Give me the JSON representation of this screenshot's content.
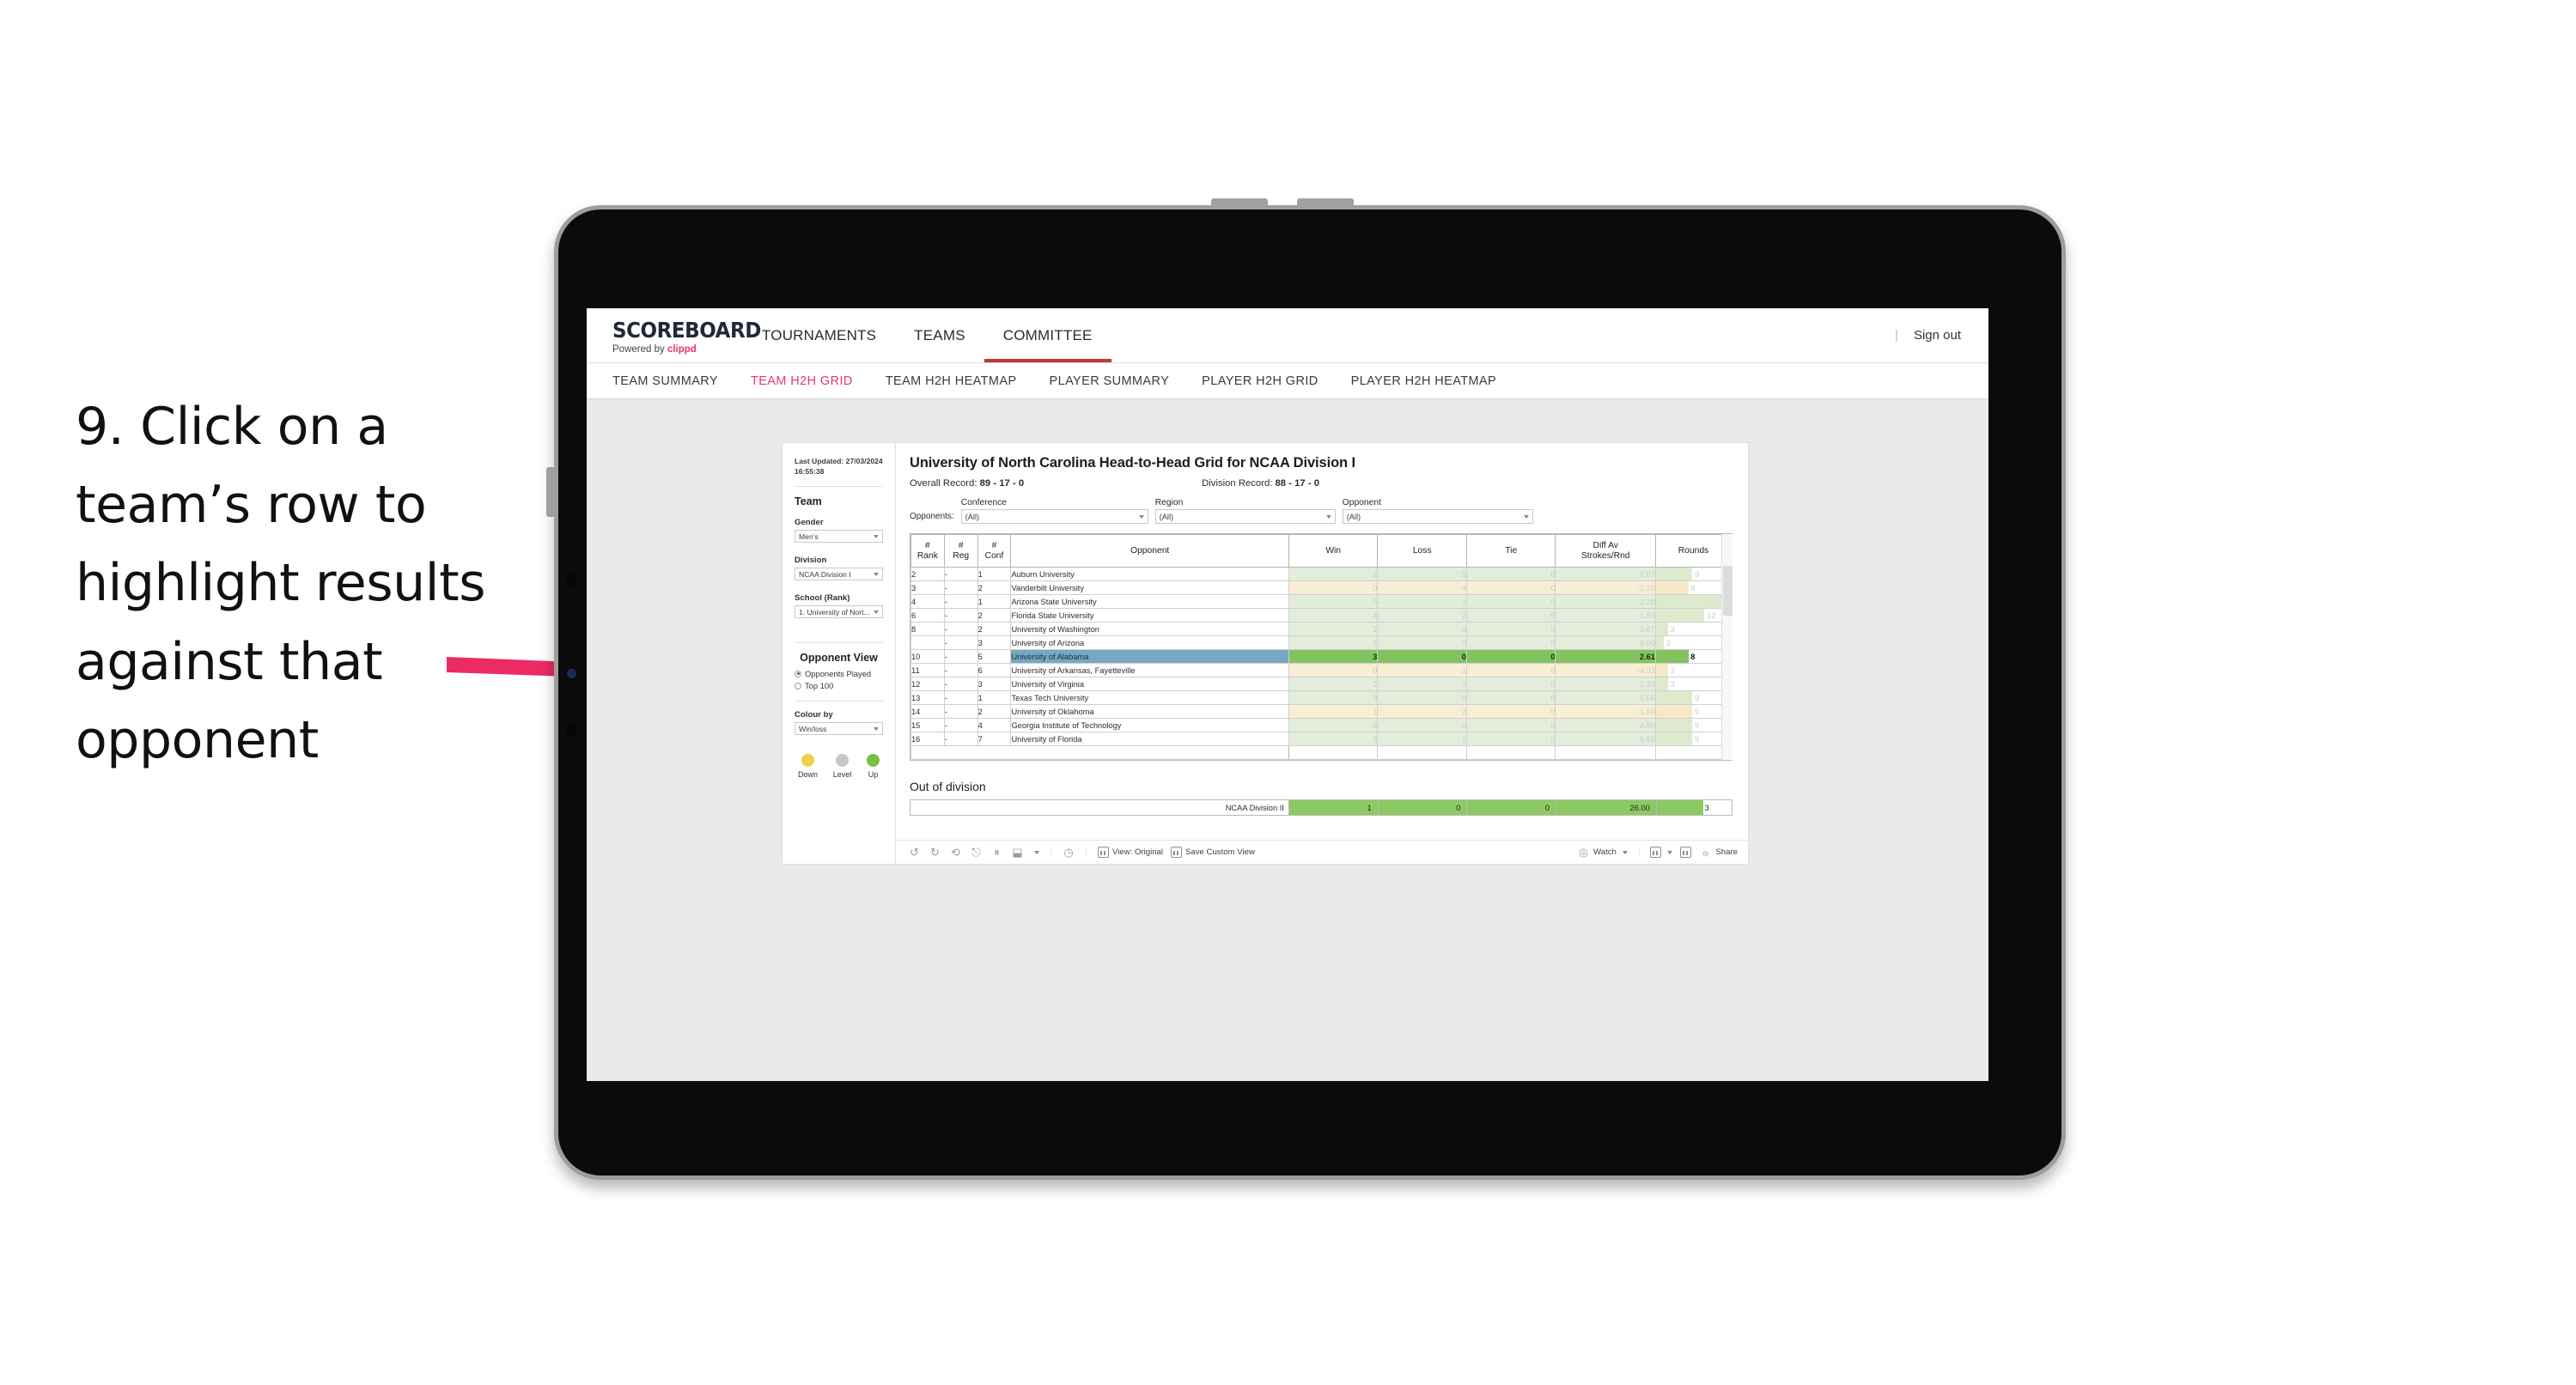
{
  "annotation": {
    "text": "9. Click on a team’s row to highlight results against that opponent",
    "arrow_color": "#ec2b63"
  },
  "app": {
    "logo": {
      "word": "SCOREBOARD",
      "powered_prefix": "Powered by ",
      "powered_brand": "clippd"
    },
    "top_nav": [
      {
        "label": "TOURNAMENTS",
        "active": false
      },
      {
        "label": "TEAMS",
        "active": false
      },
      {
        "label": "COMMITTEE",
        "active": true
      }
    ],
    "sign_out": "Sign out",
    "sign_out_separator": "|",
    "sub_nav": [
      {
        "label": "TEAM SUMMARY",
        "active": false
      },
      {
        "label": "TEAM H2H GRID",
        "active": true
      },
      {
        "label": "TEAM H2H HEATMAP",
        "active": false
      },
      {
        "label": "PLAYER SUMMARY",
        "active": false
      },
      {
        "label": "PLAYER H2H GRID",
        "active": false
      },
      {
        "label": "PLAYER H2H HEATMAP",
        "active": false
      }
    ],
    "accent_color": "#e8386a",
    "active_tab_underline": "#c0392b"
  },
  "filters_panel": {
    "last_updated": "Last Updated: 27/03/2024 16:55:38",
    "team_heading": "Team",
    "gender": {
      "label": "Gender",
      "value": "Men’s"
    },
    "division": {
      "label": "Division",
      "value": "NCAA Division I"
    },
    "school": {
      "label": "School (Rank)",
      "value": "1. University of Nort..."
    },
    "opponent_view": {
      "heading": "Opponent View",
      "options": [
        {
          "label": "Opponents Played",
          "selected": true
        },
        {
          "label": "Top 100",
          "selected": false
        }
      ]
    },
    "colour_by": {
      "label": "Colour by",
      "value": "Win/loss"
    },
    "legend": [
      {
        "label": "Down",
        "color": "#f0d04a"
      },
      {
        "label": "Level",
        "color": "#c4c6c8"
      },
      {
        "label": "Up",
        "color": "#7ac043"
      }
    ]
  },
  "viz": {
    "title": "University of North Carolina Head-to-Head Grid for NCAA Division I",
    "overall_record_label": "Overall Record:",
    "overall_record_value": "89 - 17 - 0",
    "division_record_label": "Division Record:",
    "division_record_value": "88 - 17 - 0",
    "opponents_label": "Opponents:",
    "filters": [
      {
        "title": "Conference",
        "value": "(All)"
      },
      {
        "title": "Region",
        "value": "(All)"
      },
      {
        "title": "Opponent",
        "value": "(All)"
      }
    ],
    "columns": [
      "# Rank",
      "# Reg",
      "# Conf",
      "Opponent",
      "Win",
      "Loss",
      "Tie",
      "Diff Av Strokes/Rnd",
      "Rounds"
    ],
    "column_lines": {
      "rank": [
        "#",
        "Rank"
      ],
      "reg": [
        "#",
        "Reg"
      ],
      "conf": [
        "#",
        "Conf"
      ],
      "opponent": [
        "Opponent"
      ],
      "win": [
        "Win"
      ],
      "loss": [
        "Loss"
      ],
      "tie": [
        "Tie"
      ],
      "diff": [
        "Diff Av",
        "Strokes/Rnd"
      ],
      "rounds": [
        "Rounds"
      ]
    },
    "rows": [
      {
        "rank": "2",
        "reg": "-",
        "conf": "1",
        "opponent": "Auburn University",
        "win": "2",
        "loss": "1",
        "tie": "0",
        "diff": "1.67",
        "rounds": "9",
        "state": "win",
        "selected": false
      },
      {
        "rank": "3",
        "reg": "-",
        "conf": "2",
        "opponent": "Vanderbilt University",
        "win": "0",
        "loss": "4",
        "tie": "0",
        "diff": "-2.29",
        "rounds": "8",
        "state": "loss",
        "selected": false
      },
      {
        "rank": "4",
        "reg": "-",
        "conf": "1",
        "opponent": "Arizona State University",
        "win": "5",
        "loss": "1",
        "tie": "0",
        "diff": "2.28",
        "rounds": "17",
        "state": "win",
        "selected": false
      },
      {
        "rank": "6",
        "reg": "-",
        "conf": "2",
        "opponent": "Florida State University",
        "win": "4",
        "loss": "2",
        "tie": "0",
        "diff": "1.83",
        "rounds": "12",
        "state": "win",
        "selected": false
      },
      {
        "rank": "8",
        "reg": "-",
        "conf": "2",
        "opponent": "University of Washington",
        "win": "1",
        "loss": "0",
        "tie": "0",
        "diff": "3.67",
        "rounds": "3",
        "state": "win",
        "selected": false
      },
      {
        "rank": "",
        "reg": "-",
        "conf": "3",
        "opponent": "University of Arizona",
        "win": "1",
        "loss": "0",
        "tie": "0",
        "diff": "9.00",
        "rounds": "2",
        "state": "win",
        "selected": false
      },
      {
        "rank": "10",
        "reg": "-",
        "conf": "5",
        "opponent": "University of Alabama",
        "win": "3",
        "loss": "0",
        "tie": "0",
        "diff": "2.61",
        "rounds": "8",
        "state": "win",
        "selected": true
      },
      {
        "rank": "11",
        "reg": "-",
        "conf": "6",
        "opponent": "University of Arkansas, Fayetteville",
        "win": "0",
        "loss": "1",
        "tie": "0",
        "diff": "-4.33",
        "rounds": "3",
        "state": "loss",
        "selected": false
      },
      {
        "rank": "12",
        "reg": "-",
        "conf": "3",
        "opponent": "University of Virginia",
        "win": "1",
        "loss": "0",
        "tie": "0",
        "diff": "2.33",
        "rounds": "3",
        "state": "win",
        "selected": false
      },
      {
        "rank": "13",
        "reg": "-",
        "conf": "1",
        "opponent": "Texas Tech University",
        "win": "3",
        "loss": "0",
        "tie": "0",
        "diff": "5.56",
        "rounds": "9",
        "state": "win",
        "selected": false
      },
      {
        "rank": "14",
        "reg": "-",
        "conf": "2",
        "opponent": "University of Oklahoma",
        "win": "1",
        "loss": "2",
        "tie": "0",
        "diff": "-1.00",
        "rounds": "9",
        "state": "loss",
        "selected": false
      },
      {
        "rank": "15",
        "reg": "-",
        "conf": "4",
        "opponent": "Georgia Institute of Technology",
        "win": "5",
        "loss": "0",
        "tie": "0",
        "diff": "4.50",
        "rounds": "9",
        "state": "win",
        "selected": false
      },
      {
        "rank": "16",
        "reg": "-",
        "conf": "7",
        "opponent": "University of Florida",
        "win": "3",
        "loss": "1",
        "tie": "0",
        "diff": "6.62",
        "rounds": "9",
        "state": "win",
        "selected": false
      }
    ],
    "out_of_division": {
      "heading": "Out of division",
      "row": {
        "label": "NCAA Division II",
        "win": "1",
        "loss": "0",
        "tie": "0",
        "diff": "26.00",
        "rounds": "3"
      }
    },
    "selected_row_color": "#78a7c3",
    "selected_value_color": "#82c35f"
  },
  "toolbar": {
    "icons": [
      "undo-icon",
      "redo-icon",
      "revert-icon",
      "refresh-icon",
      "pause-icon",
      "reset-icon"
    ],
    "view_label": "View: Original",
    "save_custom_view_label": "Save Custom View",
    "watch_label": "Watch",
    "share_label": "Share",
    "dropdown_caret": "▾"
  },
  "chart_data": {
    "type": "table",
    "title": "University of North Carolina Head-to-Head Grid for NCAA Division I",
    "categories": [
      "Auburn University",
      "Vanderbilt University",
      "Arizona State University",
      "Florida State University",
      "University of Washington",
      "University of Arizona",
      "University of Alabama",
      "University of Arkansas, Fayetteville",
      "University of Virginia",
      "Texas Tech University",
      "University of Oklahoma",
      "Georgia Institute of Technology",
      "University of Florida"
    ],
    "series": [
      {
        "name": "Win",
        "values": [
          2,
          0,
          5,
          4,
          1,
          1,
          3,
          0,
          1,
          3,
          1,
          5,
          3
        ]
      },
      {
        "name": "Loss",
        "values": [
          1,
          4,
          1,
          2,
          0,
          0,
          0,
          1,
          0,
          0,
          2,
          0,
          1
        ]
      },
      {
        "name": "Tie",
        "values": [
          0,
          0,
          0,
          0,
          0,
          0,
          0,
          0,
          0,
          0,
          0,
          0,
          0
        ]
      },
      {
        "name": "Diff Av Strokes/Rnd",
        "values": [
          1.67,
          -2.29,
          2.28,
          1.83,
          3.67,
          9.0,
          2.61,
          -4.33,
          2.33,
          5.56,
          -1.0,
          4.5,
          6.62
        ]
      },
      {
        "name": "Rounds",
        "values": [
          9,
          8,
          17,
          12,
          3,
          2,
          8,
          3,
          3,
          9,
          9,
          9,
          9
        ]
      }
    ],
    "rounds_max": 17,
    "highlighted_category": "University of Alabama",
    "out_of_division": {
      "category": "NCAA Division II",
      "win": 1,
      "loss": 0,
      "tie": 0,
      "diff": 26.0,
      "rounds": 3
    },
    "xlabel": "",
    "ylabel": "",
    "legend_position": "sidebar"
  }
}
